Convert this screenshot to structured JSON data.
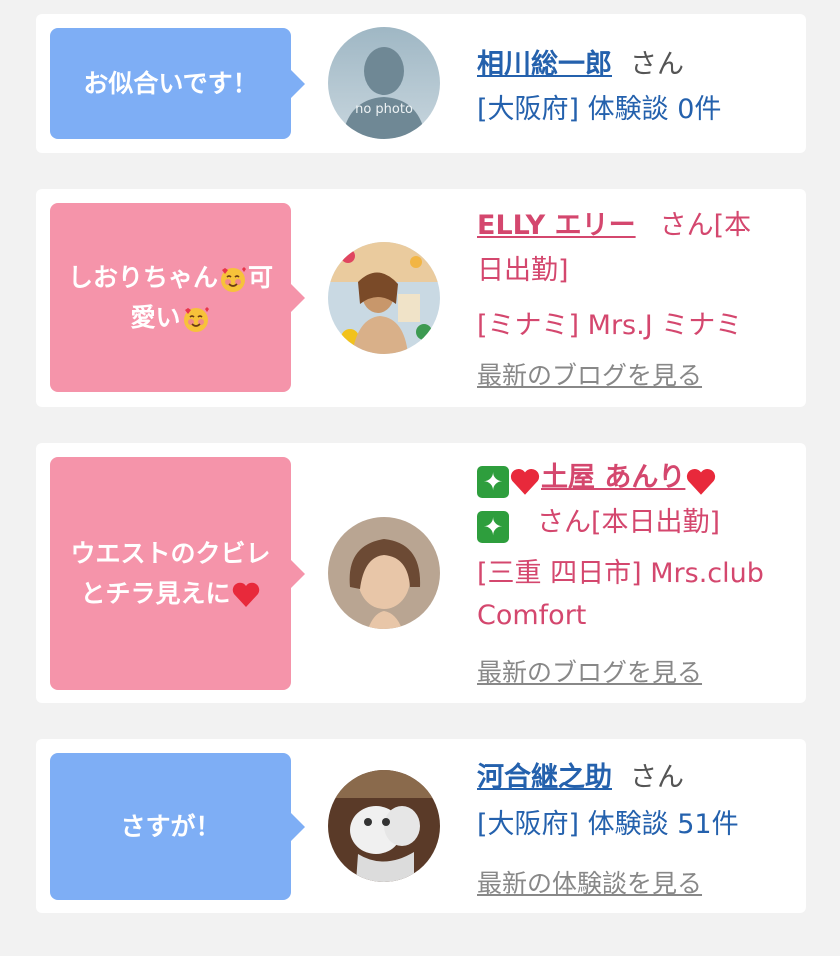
{
  "cards": [
    {
      "comment": "お似合いです！",
      "name": "相川総一郎",
      "san": "さん",
      "detail": "[大阪府] 体験談 0件",
      "avatar_text": "no photo"
    },
    {
      "comment_part1": "しおりちゃん",
      "comment_part2": "可",
      "comment_part3": "愛い",
      "name": "ELLY エリー",
      "san_line1": "さん[本",
      "san_line2": "日出勤]",
      "detail": "[ミナミ] Mrs.J ミナミ",
      "more": "最新のブログを見る"
    },
    {
      "comment_line1": "ウエストのクビレ",
      "comment_line2": "とチラ見えに",
      "name": "土屋 あんり",
      "san": "さん[本日出勤]",
      "detail_line1": "[三重 四日市] Mrs.club",
      "detail_line2": "Comfort",
      "more": "最新のブログを見る"
    },
    {
      "comment": "さすが！",
      "name": "河合継之助",
      "san": "さん",
      "detail": "[大阪府] 体験談 51件",
      "more": "最新の体験談を見る"
    }
  ],
  "colors": {
    "bubble_blue": "#7eaef5",
    "bubble_pink": "#f594aa",
    "link_blue": "#2461ad",
    "link_pink": "#d4476e"
  }
}
